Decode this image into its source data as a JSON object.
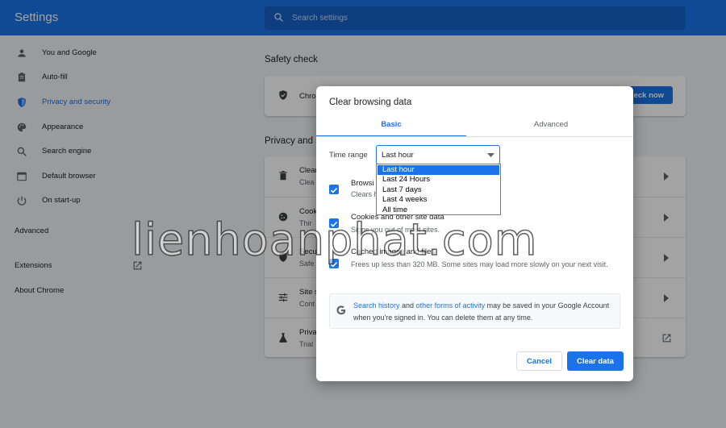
{
  "app": {
    "title": "Settings"
  },
  "search": {
    "placeholder": "Search settings"
  },
  "sidebar": {
    "items": [
      {
        "label": "You and Google",
        "icon": "person-icon"
      },
      {
        "label": "Auto-fill",
        "icon": "clipboard-icon"
      },
      {
        "label": "Privacy and security",
        "icon": "shield-icon",
        "active": true
      },
      {
        "label": "Appearance",
        "icon": "palette-icon"
      },
      {
        "label": "Search engine",
        "icon": "search-icon"
      },
      {
        "label": "Default browser",
        "icon": "browser-icon"
      },
      {
        "label": "On start-up",
        "icon": "power-icon"
      }
    ],
    "advanced": "Advanced",
    "extensions": "Extensions",
    "about": "About Chrome"
  },
  "main": {
    "safety_check": {
      "title": "Safety check",
      "row_text": "Chro",
      "button": "Check now",
      "button_visible": "eck now"
    },
    "privacy": {
      "title": "Privacy and s",
      "rows": [
        {
          "t1": "Clear",
          "t2": "Clea"
        },
        {
          "t1": "Cook",
          "t2": "Thir"
        },
        {
          "t1": "Secu",
          "t2": "Safe"
        },
        {
          "t1": "Site s",
          "t2": "Cont"
        },
        {
          "t1": "Priva",
          "t2": "Trial"
        }
      ]
    }
  },
  "dialog": {
    "title": "Clear browsing data",
    "tabs": {
      "basic": "Basic",
      "advanced": "Advanced"
    },
    "time_range": {
      "label": "Time range",
      "value": "Last hour",
      "options": [
        "Last hour",
        "Last 24 Hours",
        "Last 7 days",
        "Last 4 weeks",
        "All time"
      ]
    },
    "options": [
      {
        "title": "Browsi",
        "desc": "Clears h",
        "checked": true
      },
      {
        "title": "Cookies and other site data",
        "desc": "Signs you out of most sites.",
        "checked": true
      },
      {
        "title": "Cached images and files",
        "desc": "Frees up less than 320 MB. Some sites may load more slowly on your next visit.",
        "checked": true
      }
    ],
    "google_notice": {
      "link1": "Search history",
      "and": " and ",
      "link2": "other forms of activity",
      "rest": " may be saved in your Google Account when you're signed in. You can delete them at any time."
    },
    "buttons": {
      "cancel": "Cancel",
      "clear": "Clear data"
    }
  },
  "watermark": "lienhoanphat.com",
  "colors": {
    "accent": "#1a73e8",
    "header": "#1a73e8"
  }
}
